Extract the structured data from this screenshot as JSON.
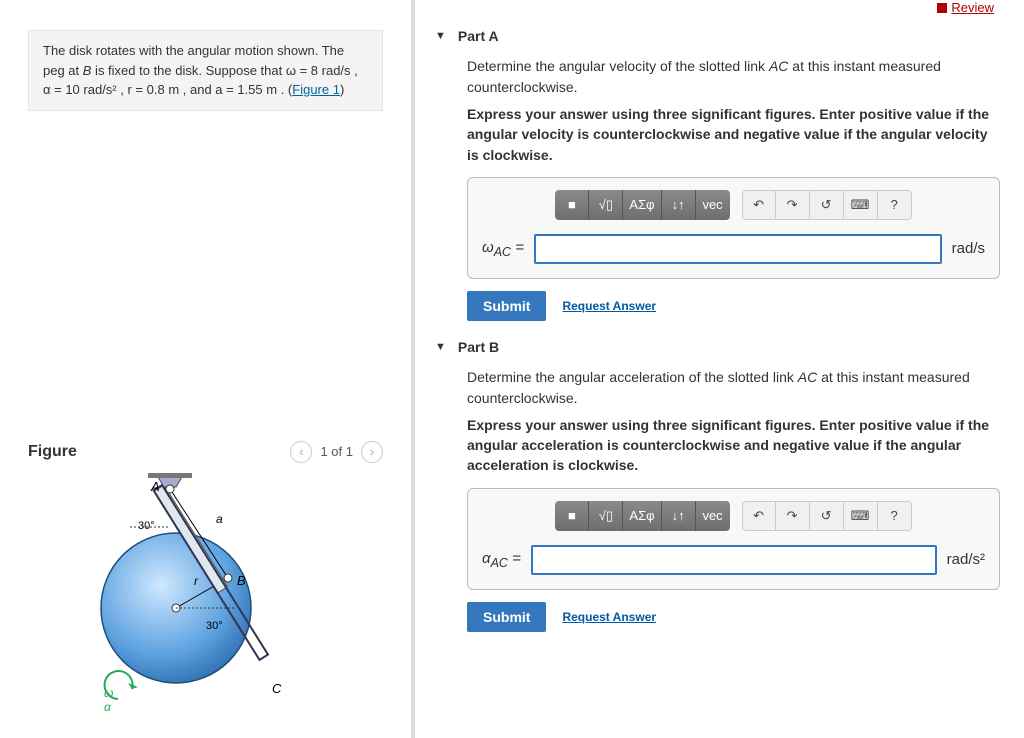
{
  "top": {
    "review": "Review"
  },
  "problem": {
    "text_pre": "The disk rotates with the angular motion shown. The peg at ",
    "var_B": "B",
    "text_mid1": " is fixed to the disk. Suppose that ",
    "eq_w": "ω = 8  rad/s",
    "sep1": " , ",
    "eq_alpha": "α = 10 rad/s²",
    "sep2": " , ",
    "eq_r": "r = 0.8  m",
    "sep3": " , and ",
    "eq_a": "a = 1.55  m",
    "sep4": " . (",
    "figlink": "Figure 1",
    "close": ")"
  },
  "figure": {
    "title": "Figure",
    "counter": "1 of 1",
    "labels": {
      "A": "A",
      "B": "B",
      "C": "C",
      "a": "a",
      "r": "r",
      "ang30a": "30°",
      "ang30b": "30°",
      "omega": "ω",
      "alpha": "α"
    }
  },
  "partA": {
    "title": "Part A",
    "question_pre": "Determine the angular velocity of the slotted link ",
    "question_var": "AC",
    "question_post": " at this instant measured counterclockwise.",
    "instruct": "Express your answer using three significant figures. Enter positive value if the angular velocity is counterclockwise and negative value if the angular velocity is clockwise.",
    "var_label": "ω",
    "var_sub": "AC",
    "eq": " =",
    "unit": "rad/s",
    "submit": "Submit",
    "request": "Request Answer"
  },
  "partB": {
    "title": "Part B",
    "question_pre": "Determine the angular acceleration of the slotted link ",
    "question_var": "AC",
    "question_post": " at this instant measured counterclockwise.",
    "instruct": "Express your answer using three significant figures. Enter positive value if the angular acceleration is counterclockwise and negative value if the angular acceleration is clockwise.",
    "var_label": "α",
    "var_sub": "AC",
    "eq": " =",
    "unit": "rad/s²",
    "submit": "Submit",
    "request": "Request Answer"
  },
  "toolbar": {
    "t1": "■",
    "t2": "√▯",
    "t3": "ΑΣφ",
    "t4": "↓↑",
    "t5": "vec",
    "undo": "↶",
    "redo": "↷",
    "reset": "↺",
    "kbd": "⌨",
    "help": "?"
  }
}
